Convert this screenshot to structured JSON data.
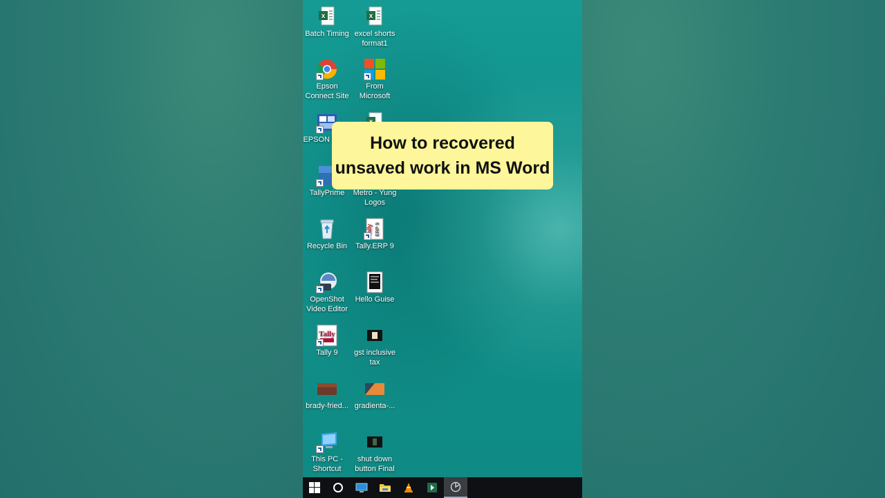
{
  "banner": {
    "line1": "How to recovered",
    "line2": "unsaved work in MS Word"
  },
  "desktop_icons": [
    {
      "label": "Batch Timing",
      "icon": "excel-file-icon"
    },
    {
      "label": "excel shorts format1",
      "icon": "excel-file-icon"
    },
    {
      "label": "Epson Connect Site",
      "icon": "chrome-icon"
    },
    {
      "label": "From Microsoft",
      "icon": "microsoft-folder-icon"
    },
    {
      "label": "EPSON Manu",
      "icon": "epson-manual-icon"
    },
    {
      "label": "",
      "icon": "excel-file-icon"
    },
    {
      "label": "TallyPrime",
      "icon": "tallyprime-icon"
    },
    {
      "label": "Metro - Yung Logos",
      "icon": "image-file-icon"
    },
    {
      "label": "Recycle Bin",
      "icon": "recycle-bin-icon"
    },
    {
      "label": "Tally.ERP 9",
      "icon": "tally-erp9-icon"
    },
    {
      "label": "OpenShot Video Editor",
      "icon": "openshot-icon"
    },
    {
      "label": "Hello Guise",
      "icon": "document-icon"
    },
    {
      "label": "Tally 9",
      "icon": "tally9-icon"
    },
    {
      "label": "gst inclusive tax",
      "icon": "video-thumbnail-icon"
    },
    {
      "label": "brady-fried...",
      "icon": "image-thumbnail-icon"
    },
    {
      "label": "gradienta-...",
      "icon": "gradient-image-icon"
    },
    {
      "label": "This PC - Shortcut",
      "icon": "this-pc-icon"
    },
    {
      "label": "shut down button Final",
      "icon": "video-thumbnail-icon"
    }
  ],
  "taskbar": {
    "items": [
      "start-windows-icon",
      "search-cortana-icon",
      "desktop-monitor-icon",
      "file-explorer-icon",
      "vlc-icon",
      "app-green-icon",
      "openshot-taskbar-icon"
    ]
  },
  "colors": {
    "banner_bg": "#fdf69a",
    "desktop_teal": "#11908a",
    "taskbar": "#0e1014"
  }
}
